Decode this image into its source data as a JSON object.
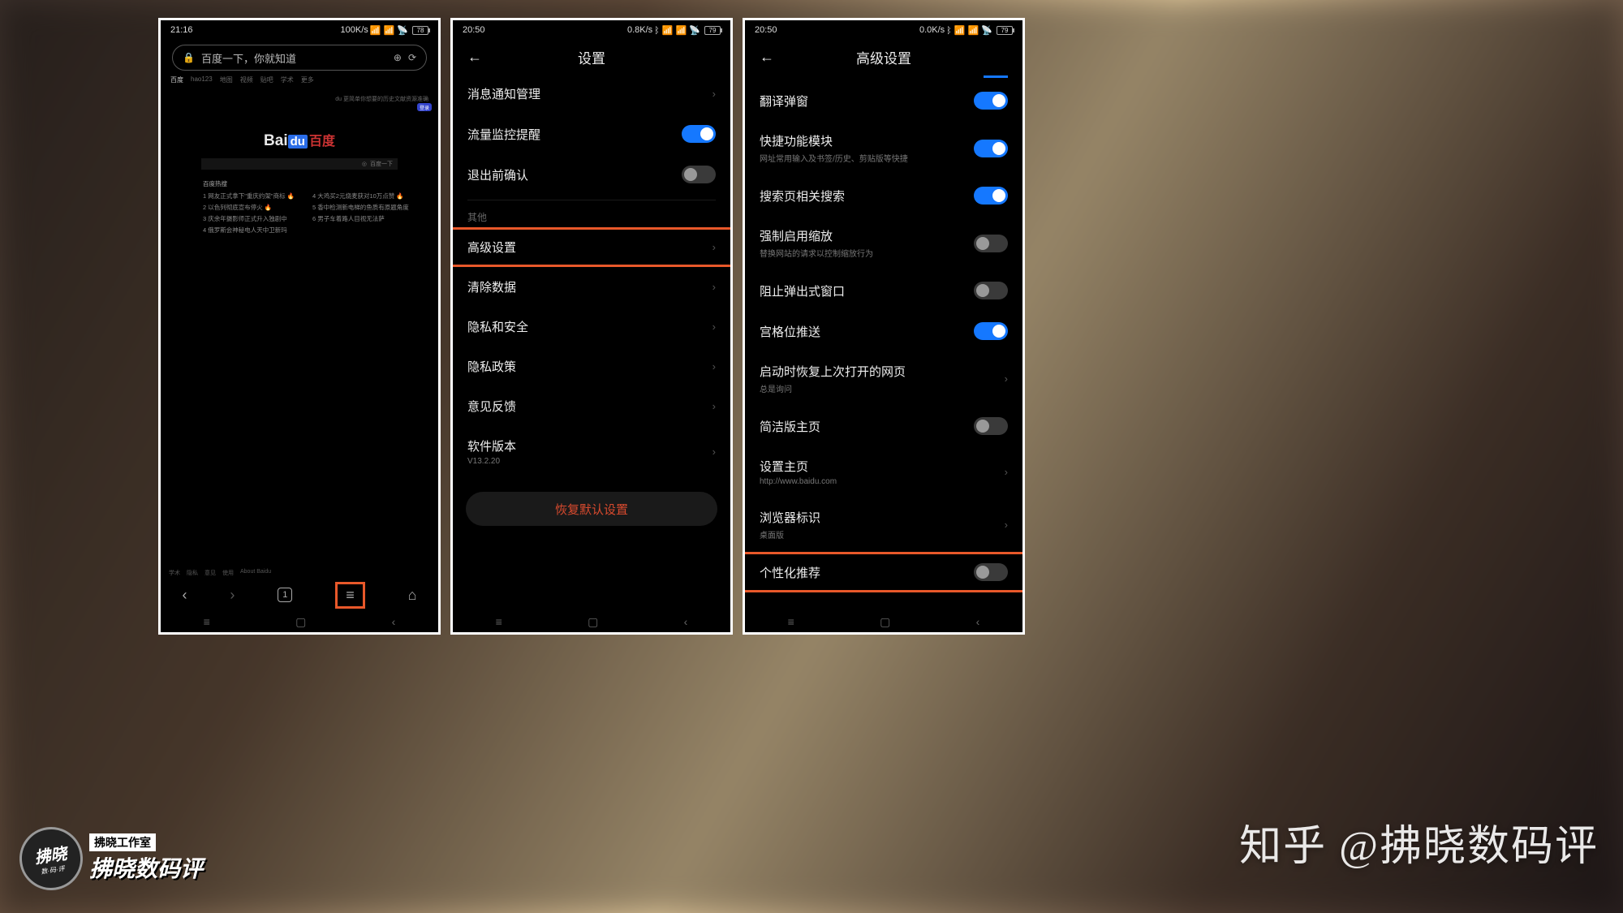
{
  "colors": {
    "accent": "#1578ff",
    "highlight": "#e8582a",
    "danger": "#d84a2e"
  },
  "watermark": "知乎 @拂晓数码评",
  "stamp": {
    "circle": "拂晓",
    "sub": "数·码·评",
    "line1": "拂晓工作室",
    "line2": "拂晓数码评"
  },
  "phone1": {
    "time": "21:16",
    "netspeed": "100K/s",
    "battery": "78",
    "url_placeholder": "百度一下，你就知道",
    "tabs": [
      "百度",
      "hao123",
      "地图",
      "视频",
      "贴吧",
      "学术",
      "更多"
    ],
    "tagline": "du 更简单你想要的历史文献资源准确",
    "btn": "登录",
    "logo_bai": "Bai",
    "logo_du": "du",
    "logo_zh": "百度",
    "search_btn": "百度一下",
    "hot_title": "百度热搜",
    "hot_left": [
      "1 网友正式拿下\"重庆约架\"商标 🔥",
      "2 以色列彻底宣布停火 🔥",
      "3 庆余年摄影师正式升入独剧中",
      "4 俄罗斯会神秘电人天中卫新玛"
    ],
    "hot_right": [
      "4 大鸡买2元烧麦获对10万点赞 🔥",
      "5 香中检测新电梯的鱼质有原题角度",
      "6 男子车着路人目视无法萨"
    ],
    "footer": [
      "学术",
      "隐私",
      "意见",
      "使用",
      "About Baidu"
    ],
    "toolbar_count": "1"
  },
  "phone2": {
    "time": "20:50",
    "netspeed": "0.8K/s",
    "battery": "79",
    "title": "设置",
    "items": [
      {
        "label": "消息通知管理",
        "type": "chev"
      },
      {
        "label": "流量监控提醒",
        "type": "toggle",
        "on": true
      },
      {
        "label": "退出前确认",
        "type": "toggle",
        "on": false
      }
    ],
    "section": "其他",
    "items2": [
      {
        "label": "高级设置",
        "type": "chev",
        "hl": true
      },
      {
        "label": "清除数据",
        "type": "chev"
      },
      {
        "label": "隐私和安全",
        "type": "chev"
      },
      {
        "label": "隐私政策",
        "type": "chev"
      },
      {
        "label": "意见反馈",
        "type": "chev"
      },
      {
        "label": "软件版本",
        "sub": "V13.2.20",
        "type": "chev"
      }
    ],
    "restore": "恢复默认设置"
  },
  "phone3": {
    "time": "20:50",
    "netspeed": "0.0K/s",
    "battery": "79",
    "title": "高级设置",
    "items": [
      {
        "label": "翻译弹窗",
        "type": "toggle",
        "on": true
      },
      {
        "label": "快捷功能模块",
        "sub": "网址常用输入及书签/历史、剪贴版等快捷",
        "type": "toggle",
        "on": true
      },
      {
        "label": "搜索页相关搜索",
        "type": "toggle",
        "on": true
      },
      {
        "label": "强制启用缩放",
        "sub": "替换网站的请求以控制缩放行为",
        "type": "toggle",
        "on": false
      },
      {
        "label": "阻止弹出式窗口",
        "type": "toggle",
        "on": false
      },
      {
        "label": "宫格位推送",
        "type": "toggle",
        "on": true
      },
      {
        "label": "启动时恢复上次打开的网页",
        "sub": "总是询问",
        "type": "chev"
      },
      {
        "label": "简洁版主页",
        "type": "toggle",
        "on": false
      },
      {
        "label": "设置主页",
        "sub": "http://www.baidu.com",
        "type": "chev"
      },
      {
        "label": "浏览器标识",
        "sub": "桌面版",
        "type": "chev"
      },
      {
        "label": "个性化推荐",
        "type": "toggle",
        "on": false,
        "hl": true
      }
    ]
  }
}
